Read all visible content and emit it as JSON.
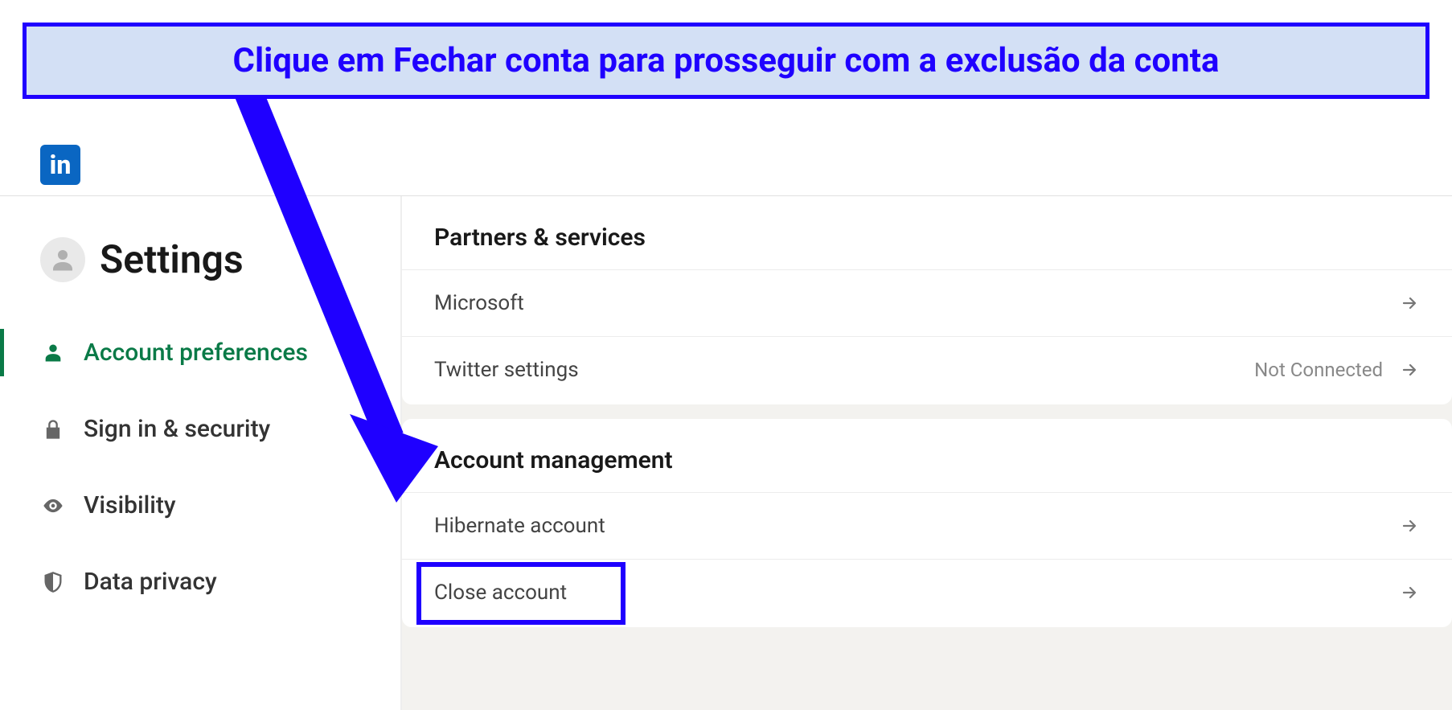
{
  "callout": {
    "text": "Clique em Fechar conta para prosseguir com a exclusão da conta"
  },
  "header": {
    "logo_text": "in"
  },
  "sidebar": {
    "title": "Settings",
    "nav": [
      {
        "label": "Account preferences",
        "icon": "person-icon",
        "active": true
      },
      {
        "label": "Sign in & security",
        "icon": "lock-icon",
        "active": false
      },
      {
        "label": "Visibility",
        "icon": "eye-icon",
        "active": false
      },
      {
        "label": "Data privacy",
        "icon": "shield-icon",
        "active": false
      }
    ]
  },
  "sections": [
    {
      "title": "Partners & services",
      "rows": [
        {
          "label": "Microsoft",
          "status": ""
        },
        {
          "label": "Twitter settings",
          "status": "Not Connected"
        }
      ]
    },
    {
      "title": "Account management",
      "rows": [
        {
          "label": "Hibernate account",
          "status": ""
        },
        {
          "label": "Close account",
          "status": ""
        }
      ]
    }
  ]
}
